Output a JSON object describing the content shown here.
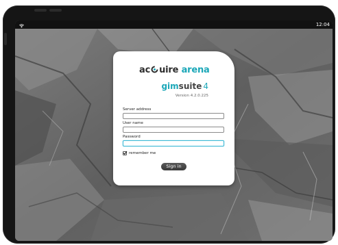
{
  "status_bar": {
    "time": "12:04",
    "wifi_icon": "wifi-icon"
  },
  "login": {
    "brand_left": "ac",
    "brand_middle": "uire",
    "brand_right": "arena",
    "brand_c_icon": "acquire-q-logo-icon",
    "product_prefix": "gim",
    "product_name": "suite",
    "product_number": "4",
    "version": "Version 4.2.0.225",
    "server_label": "Server address",
    "server_value": "",
    "username_label": "User name",
    "username_value": "",
    "password_label": "Password",
    "password_value": "",
    "remember_label": "remember me",
    "remember_checked": true,
    "signin_label": "Sign in"
  },
  "colors": {
    "accent": "#1ba7b8",
    "dark_text": "#2d2d2d",
    "button": "#444444",
    "focus_border": "#3fb9d6"
  }
}
